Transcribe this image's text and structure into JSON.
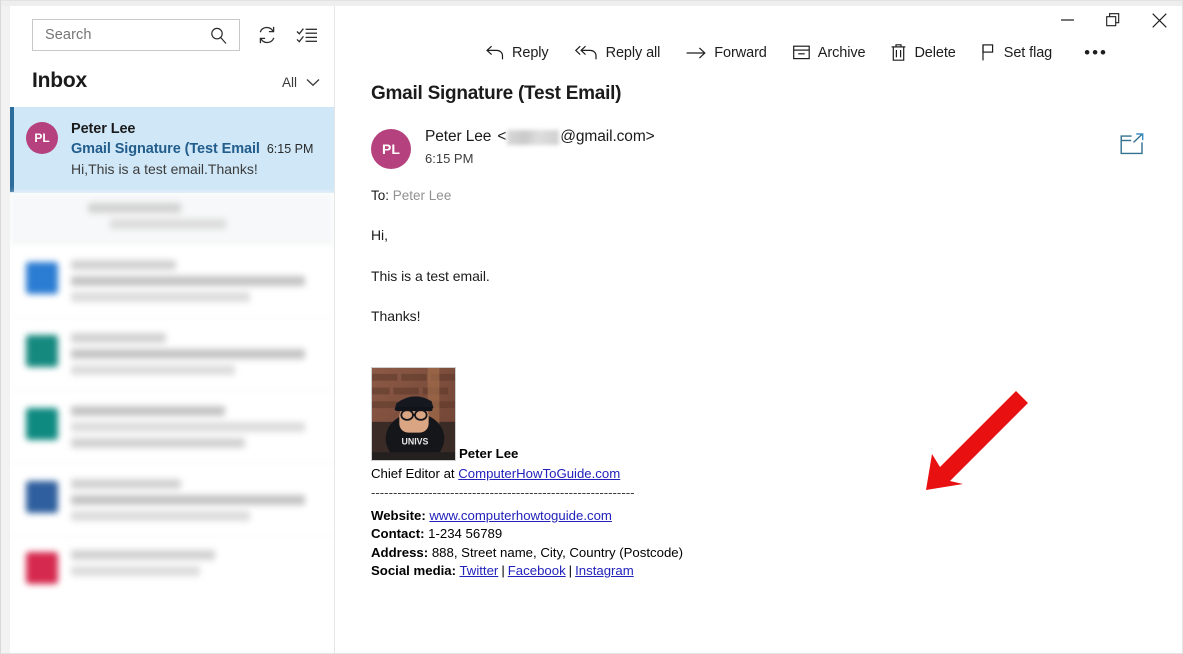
{
  "window": {
    "controls": [
      {
        "name": "minimize",
        "label": "Minimize"
      },
      {
        "name": "restore",
        "label": "Restore"
      },
      {
        "name": "close",
        "label": "Close"
      }
    ]
  },
  "sidebar": {
    "search": {
      "placeholder": "Search",
      "icon": "search-icon"
    },
    "sync_icon": "sync-icon",
    "select_mode_icon": "checklist-icon",
    "folder_title": "Inbox",
    "filter": {
      "label": "All",
      "icon": "chevron-down-icon"
    },
    "messages": [
      {
        "selected": true,
        "initials": "PL",
        "avatar_color": "#b5427e",
        "from": "Peter Lee",
        "subject": "Gmail Signature (Test Email",
        "time": "6:15 PM",
        "preview": "Hi,This is a test email.Thanks!"
      },
      {
        "selected": false,
        "redacted": true,
        "avatar_color": "none"
      },
      {
        "selected": false,
        "redacted": true,
        "avatar_color": "#2b7cd3"
      },
      {
        "selected": false,
        "redacted": true,
        "avatar_color": "#16897f"
      },
      {
        "selected": false,
        "redacted": true,
        "avatar_color": "#0e8a80"
      },
      {
        "selected": false,
        "redacted": true,
        "avatar_color": "#2f5f9e"
      },
      {
        "selected": false,
        "redacted": true,
        "avatar_color": "#d6294f"
      }
    ]
  },
  "toolbar": {
    "items": [
      {
        "label": "Reply",
        "icon": "reply-icon"
      },
      {
        "label": "Reply all",
        "icon": "reply-all-icon"
      },
      {
        "label": "Forward",
        "icon": "forward-arrow-icon"
      },
      {
        "label": "Archive",
        "icon": "archive-box-icon"
      },
      {
        "label": "Delete",
        "icon": "trash-icon"
      },
      {
        "label": "Set flag",
        "icon": "flag-icon"
      }
    ],
    "overflow_label": "•••"
  },
  "email": {
    "subject": "Gmail Signature (Test Email)",
    "sender_initials": "PL",
    "sender_avatar_color": "#b5427e",
    "sender_name": "Peter Lee",
    "sender_email_prefix": "<",
    "sender_email_domain": "@gmail.com>",
    "sender_email_redacted": true,
    "time": "6:15 PM",
    "popout_icon": "open-in-new-window-icon",
    "to_label": "To:",
    "to_value": "Peter Lee",
    "body": [
      "Hi,",
      "This is a test email.",
      "Thanks!"
    ]
  },
  "signature": {
    "photo_alt": "Portrait of Peter Lee wearing a cap and glasses against a brick wall",
    "name": "Peter Lee",
    "role_prefix": "Chief Editor at ",
    "role_link": "ComputerHowToGuide.com",
    "separator": "------------------------------------------------------------",
    "rows": [
      {
        "label": "Website:",
        "link": "www.computerhowtoguide.com"
      },
      {
        "label": "Contact:",
        "value": "1-234 56789"
      },
      {
        "label": "Address:",
        "value": "888, Street name, City, Country (Postcode)"
      }
    ],
    "social_label": "Social media:",
    "social_links": [
      "Twitter",
      "Facebook",
      "Instagram"
    ],
    "social_divider": "|"
  },
  "annotation": {
    "arrow_color": "#e81010",
    "arrow_name": "red-pointer-arrow"
  }
}
